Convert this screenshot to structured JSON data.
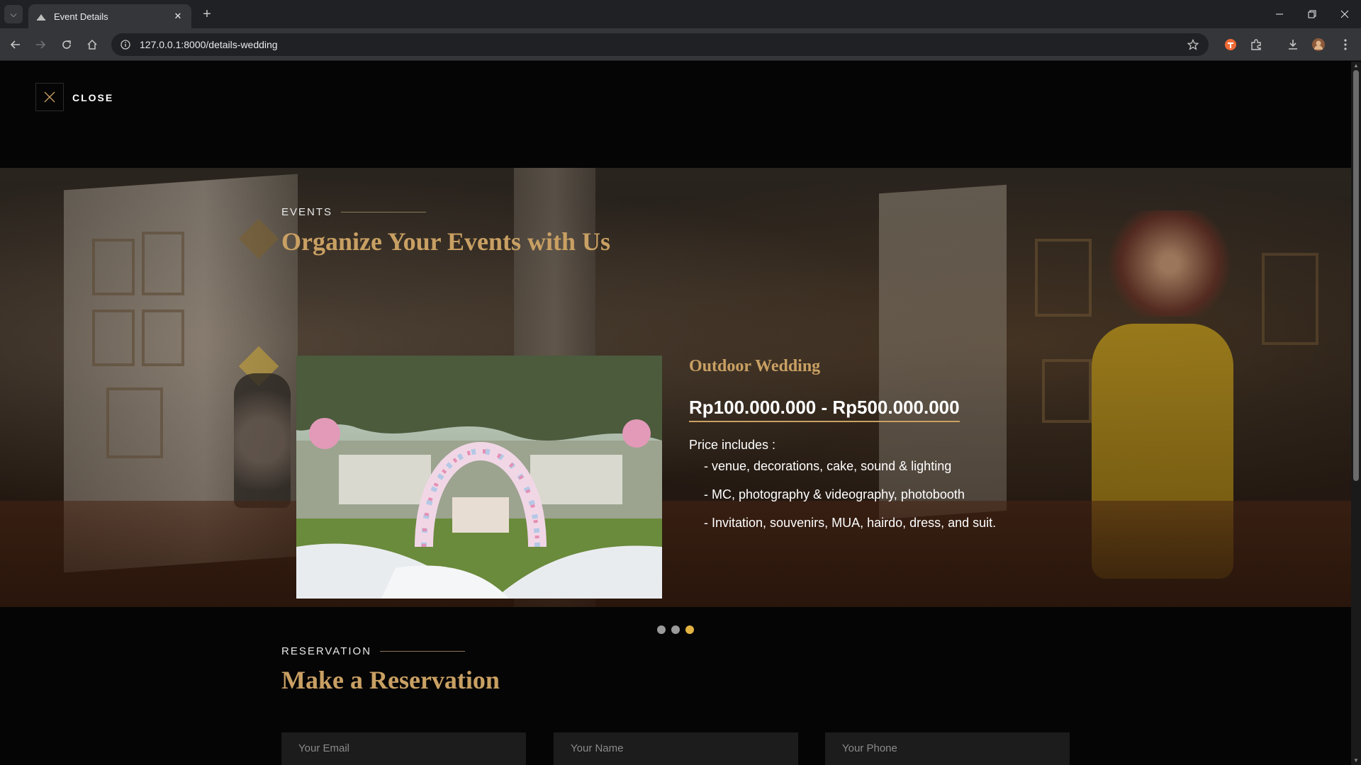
{
  "browser": {
    "tab_title": "Event Details",
    "url": "127.0.0.1:8000/details-wedding"
  },
  "page": {
    "close_label": "CLOSE",
    "events_tag": "EVENTS",
    "events_title": "Organize Your Events with Us",
    "event": {
      "name": "Outdoor Wedding",
      "price": "Rp100.000.000 - Rp500.000.000",
      "includes_label": "Price includes :",
      "includes": [
        "- venue, decorations, cake, sound & lighting",
        "- MC, photography & videography, photobooth",
        "- Invitation, souvenirs, MUA, hairdo, dress, and suit."
      ]
    },
    "carousel": {
      "slides": 3,
      "active_slide": 3
    },
    "reservation_tag": "RESERVATION",
    "reservation_title": "Make a Reservation",
    "form": {
      "email_placeholder": "Your Email",
      "name_placeholder": "Your Name",
      "phone_placeholder": "Your Phone"
    }
  },
  "colors": {
    "accent_gold": "#c9a063",
    "active_dot": "#e3b342",
    "page_bg": "#050505"
  }
}
